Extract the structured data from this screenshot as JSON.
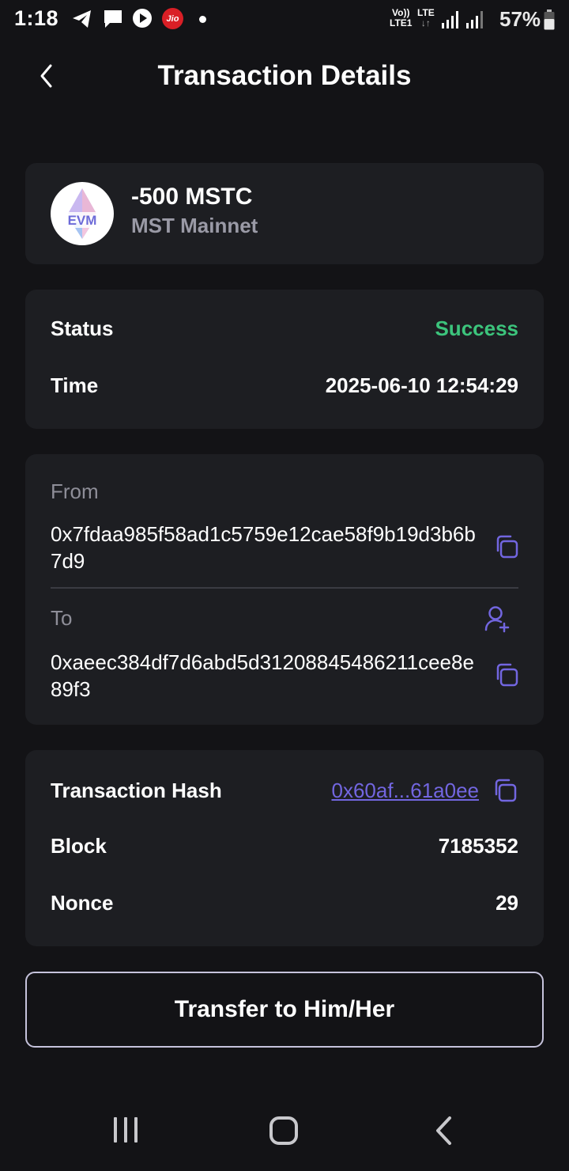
{
  "status_bar": {
    "time": "1:18",
    "carrier_badge": "Jio",
    "volte": "Vo))",
    "lte1": "LTE1",
    "lte": "LTE",
    "lte_arrows": "↓↑",
    "battery": "57%",
    "icons": [
      "telegram-icon",
      "message-icon",
      "youtube-play-icon",
      "jio-icon",
      "notification-dot",
      "signal-icon",
      "signal-icon",
      "battery-icon"
    ]
  },
  "header": {
    "title": "Transaction Details",
    "back_icon": "chevron-left-icon"
  },
  "asset": {
    "amount": "-500 MSTC",
    "network": "MST Mainnet",
    "logo_text": "EVM"
  },
  "summary": {
    "status_label": "Status",
    "status_value": "Success",
    "time_label": "Time",
    "time_value": "2025-06-10 12:54:29"
  },
  "addresses": {
    "from_label": "From",
    "from_value": "0x7fdaa985f58ad1c5759e12cae58f9b19d3b6b7d9",
    "to_label": "To",
    "to_value": "0xaeec384df7d6abd5d31208845486211cee8e89f3"
  },
  "details": {
    "hash_label": "Transaction Hash",
    "hash_value": "0x60af...61a0ee",
    "block_label": "Block",
    "block_value": "7185352",
    "nonce_label": "Nonce",
    "nonce_value": "29"
  },
  "actions": {
    "transfer_label": "Transfer to Him/Her"
  },
  "colors": {
    "background": "#131316",
    "card": "#1d1e22",
    "success": "#3cc47c",
    "accent": "#7266e0",
    "muted": "#8e8e98"
  }
}
